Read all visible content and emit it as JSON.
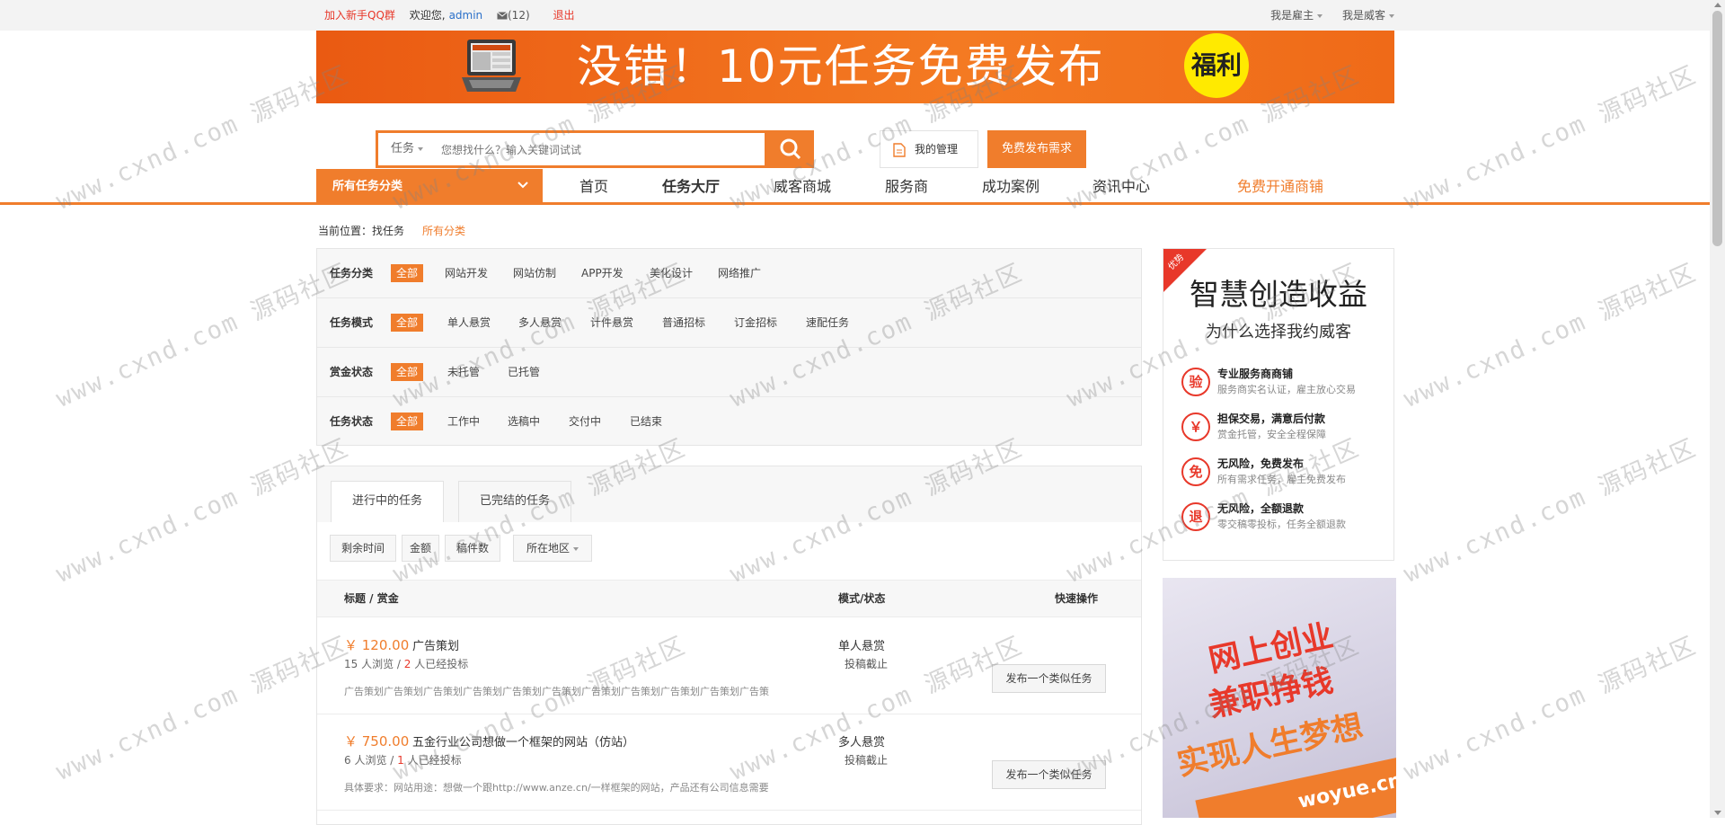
{
  "topbar": {
    "join_qq": "加入新手QQ群",
    "welcome": "欢迎您,",
    "username": "admin",
    "messages": "(12)",
    "logout": "退出",
    "employer": "我是雇主",
    "freelancer": "我是威客"
  },
  "banner": {
    "text": "没错！10元任务免费发布",
    "badge": "福利"
  },
  "search": {
    "type": "任务",
    "placeholder": "您想找什么？输入关键词试试",
    "my_manage": "我的管理",
    "publish_free": "免费发布需求"
  },
  "nav": {
    "all_categories": "所有任务分类",
    "items": [
      "首页",
      "任务大厅",
      "威客商城",
      "服务商",
      "成功案例",
      "资讯中心"
    ],
    "open_shop": "免费开通商铺"
  },
  "breadcrumb": {
    "current": "当前位置：找任务",
    "all": "所有分类"
  },
  "filters": [
    {
      "label": "任务分类",
      "options": [
        "全部",
        "网站开发",
        "网站仿制",
        "APP开发",
        "美化设计",
        "网络推广"
      ]
    },
    {
      "label": "任务模式",
      "options": [
        "全部",
        "单人悬赏",
        "多人悬赏",
        "计件悬赏",
        "普通招标",
        "订金招标",
        "速配任务"
      ]
    },
    {
      "label": "赏金状态",
      "options": [
        "全部",
        "未托管",
        "已托管"
      ]
    },
    {
      "label": "任务状态",
      "options": [
        "全部",
        "工作中",
        "选稿中",
        "交付中",
        "已结束"
      ]
    }
  ],
  "tabs": [
    "进行中的任务",
    "已完结的任务"
  ],
  "sort": [
    "剩余时间",
    "金额",
    "稿件数",
    "所在地区"
  ],
  "table": {
    "col_title": "标题 / 赏金",
    "col_mode": "模式/状态",
    "col_action": "快速操作"
  },
  "tasks": [
    {
      "price": "￥ 120.00",
      "title": "广告策划",
      "views": "15",
      "views_unit": "人浏览 /",
      "bids": "2",
      "bids_unit": "人已经投标",
      "desc": "广告策划广告策划广告策划广告策划广告策划广告策划广告策划广告策划广告策划广告策划广告策",
      "mode": "单人悬赏",
      "status": "投稿截止",
      "action": "发布一个类似任务"
    },
    {
      "price": "￥ 750.00",
      "title": "五金行业公司想做一个框架的网站（仿站）",
      "views": "6",
      "views_unit": "人浏览 /",
      "bids": "1",
      "bids_unit": "人已经投标",
      "desc": "具体要求：网站用途：想做一个跟http://www.anze.cn/一样框架的网站，产品还有公司信息需要",
      "mode": "多人悬赏",
      "status": "投稿截止",
      "action": "发布一个类似任务"
    }
  ],
  "side_ad": {
    "corner": "优势",
    "title": "智慧创造收益",
    "subtitle": "为什么选择我约威客",
    "features": [
      {
        "icon": "验",
        "title": "专业服务商商铺",
        "desc": "服务商实名认证，雇主放心交易"
      },
      {
        "icon": "￥",
        "title": "担保交易，满意后付款",
        "desc": "赏金托管，安全全程保障"
      },
      {
        "icon": "免",
        "title": "无风险，免费发布",
        "desc": "所有需求任务，雇主免费发布"
      },
      {
        "icon": "退",
        "title": "无风险，全额退款",
        "desc": "零交稿零投标，任务全额退款"
      }
    ]
  },
  "side_ad2": {
    "line1": "网上创业",
    "line2": "兼职挣钱",
    "line3": "实现人生梦想",
    "url": "woyue.cn"
  },
  "watermark": "www.cxnd.com 源码社区",
  "colors": {
    "accent": "#f07d2c",
    "red": "#e8382a",
    "link": "#2a70c9"
  }
}
